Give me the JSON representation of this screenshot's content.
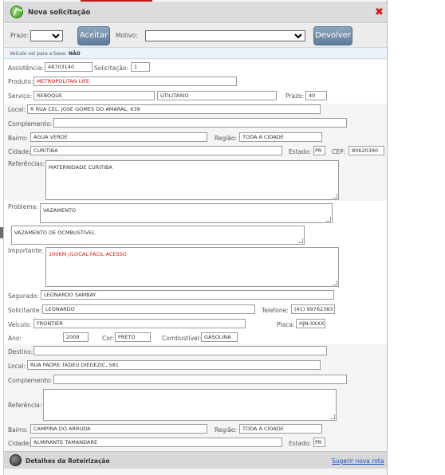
{
  "window": {
    "title": "Nova solicitação"
  },
  "toolbar": {
    "prazo_label": "Prazo:",
    "prazo_value": "",
    "accept_label": "Aceitar",
    "motivo_label": "Motivo:",
    "motivo_value": "",
    "return_label": "Devolver"
  },
  "info": {
    "vehicle_base_label": "Veículo vai para a base:",
    "vehicle_base_value": "NÃO"
  },
  "form": {
    "assistencia_label": "Assistência:",
    "assistencia": "48703140",
    "solicitacao_label": "Solicitação:",
    "solicitacao": "1",
    "produto_label": "Produto:",
    "produto": "METROPOLITAN LIFE",
    "servico_label": "Serviço:",
    "servico": "REBOQUE",
    "servico2": "UTILITÁRIO",
    "prazo_label": "Prazo:",
    "prazo": "40",
    "local_label": "Local:",
    "local": "R RUA CEL. JOSE GOMES DO AMARAL, 639",
    "complemento_label": "Complemento:",
    "complemento": "",
    "bairro_label": "Bairro:",
    "bairro": "AGUA VERDE",
    "regiao_label": "Região:",
    "regiao": "TODA A CIDADE",
    "cidade_label": "Cidade:",
    "cidade": "CURITIBA",
    "estado_label": "Estado:",
    "estado": "PR",
    "cep_label": "CEP:",
    "cep": "80620380",
    "referencias_label": "Referências:",
    "referencias": "MATERNIDADE CURITIBA",
    "problema_label": "Problema:",
    "problema": "VAZAMENTO",
    "problema_detail": "VAZAMENTO DE OCMBUSTIVEL",
    "importante_label": "Importante:",
    "importante": "100KM //LOCAL FACIL ACESSO",
    "segurado_label": "Segurado:",
    "segurado": "LEONARDO SAMBAY",
    "solicitante_label": "Solicitante:",
    "solicitante": "LEONARDO",
    "telefone_label": "Telefone:",
    "telefone": "(41) 99762383",
    "veiculo_label": "Veículo:",
    "veiculo": "FRONTIER",
    "placa_label": "Placa:",
    "placa": "HJN-XXXX",
    "ano_label": "Ano:",
    "ano": "2009",
    "cor_label": "Cor:",
    "cor": "PRETO",
    "combustivel_label": "Combustível:",
    "combustivel": "GASOLINA"
  },
  "destino": {
    "destino_label": "Destino:",
    "destino": "",
    "local_label": "Local:",
    "local": "RUA PADRE TADEU DIEDEZIC, 581",
    "complemento_label": "Complemento:",
    "complemento": "",
    "referencia_label": "Referência:",
    "referencia": "",
    "bairro_label": "Bairro:",
    "bairro": "CAMPINA DO ARRUDA",
    "regiao_label": "Região:",
    "regiao": "TODA A CIDADE",
    "cidade_label": "Cidade:",
    "cidade": "ALMIRANTE TAMANDARE",
    "estado_label": "Estado:",
    "estado": "PR"
  },
  "footer": {
    "title": "Detalhes da Roteirização",
    "link": "Sugerir nova rota"
  },
  "colors": {
    "accent": "#5e7c9b",
    "close": "#dd1111",
    "link": "#1a4fb8",
    "highlight_text": "#dd1111"
  }
}
